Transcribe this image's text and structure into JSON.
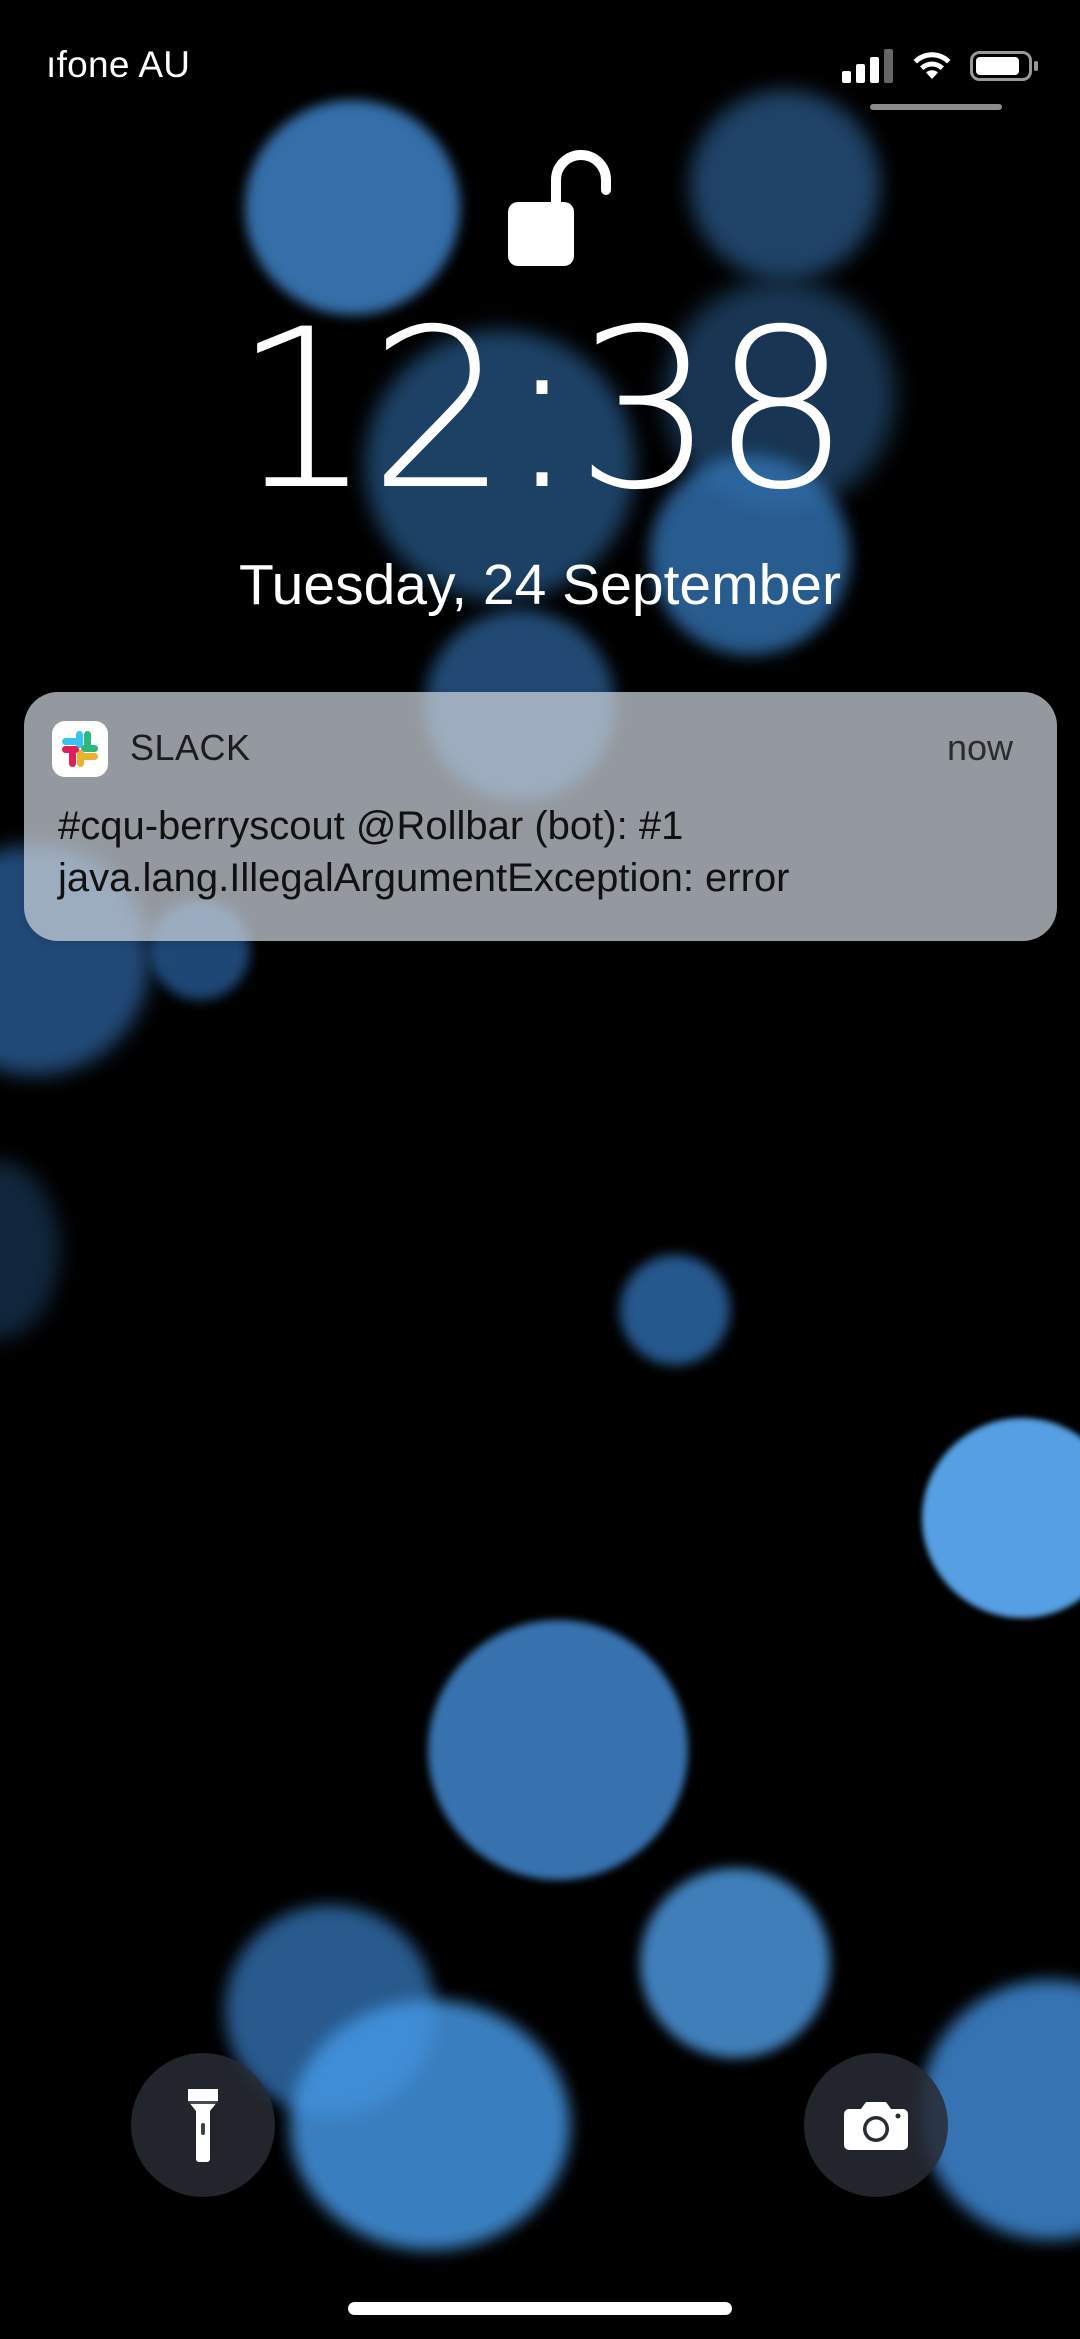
{
  "status_bar": {
    "carrier": "ıfone AU",
    "signal_icon": "cellular-signal-icon",
    "wifi_icon": "wifi-icon",
    "battery_icon": "battery-icon",
    "battery_level": 0.85
  },
  "lock_screen": {
    "lock_icon": "unlocked-padlock-icon",
    "time": "12:38",
    "date": "Tuesday, 24 September"
  },
  "notification": {
    "app_icon": "slack-logo-icon",
    "app_name": "SLACK",
    "time": "now",
    "body_lines": [
      "#cqu-berryscout @Rollbar (bot): #1",
      "java.lang.IllegalArgumentException: error"
    ]
  },
  "bottom_controls": {
    "flashlight_icon": "flashlight-icon",
    "camera_icon": "camera-icon"
  },
  "colors": {
    "background": "#000000",
    "bokeh_blue": "#4a9ee8",
    "notification_bg": "#cdd4dc",
    "slack_blue": "#36C5F0",
    "slack_green": "#2EB67D",
    "slack_yellow": "#ECB22E",
    "slack_red": "#E01E5A"
  }
}
